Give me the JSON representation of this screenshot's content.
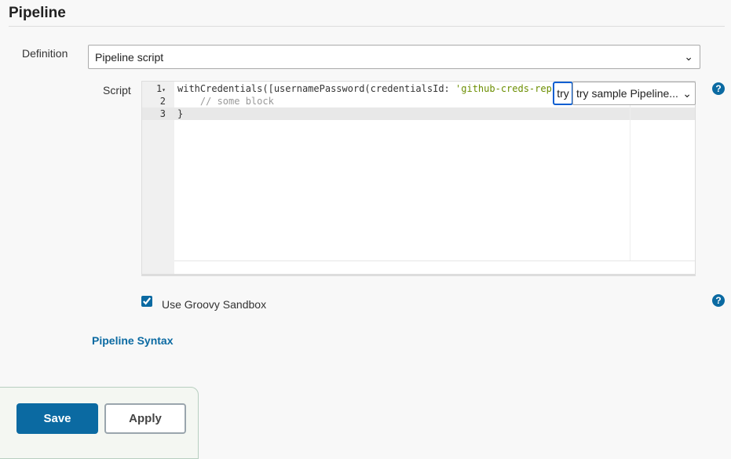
{
  "section": {
    "title": "Pipeline"
  },
  "definition": {
    "label": "Definition",
    "value": "Pipeline script"
  },
  "script": {
    "label": "Script",
    "lines": [
      {
        "num": "1",
        "code": "withCredentials([usernamePassword(credentialsId: ",
        "string": "'github-creds-rep"
      },
      {
        "num": "2",
        "code": "    // some block"
      },
      {
        "num": "3",
        "code": "}"
      }
    ],
    "try_button": "try",
    "sample_select": "try sample Pipeline..."
  },
  "sandbox": {
    "label": "Use Groovy Sandbox",
    "checked": true
  },
  "syntax_link": "Pipeline Syntax",
  "help": "?",
  "buttons": {
    "save": "Save",
    "apply": "Apply"
  }
}
